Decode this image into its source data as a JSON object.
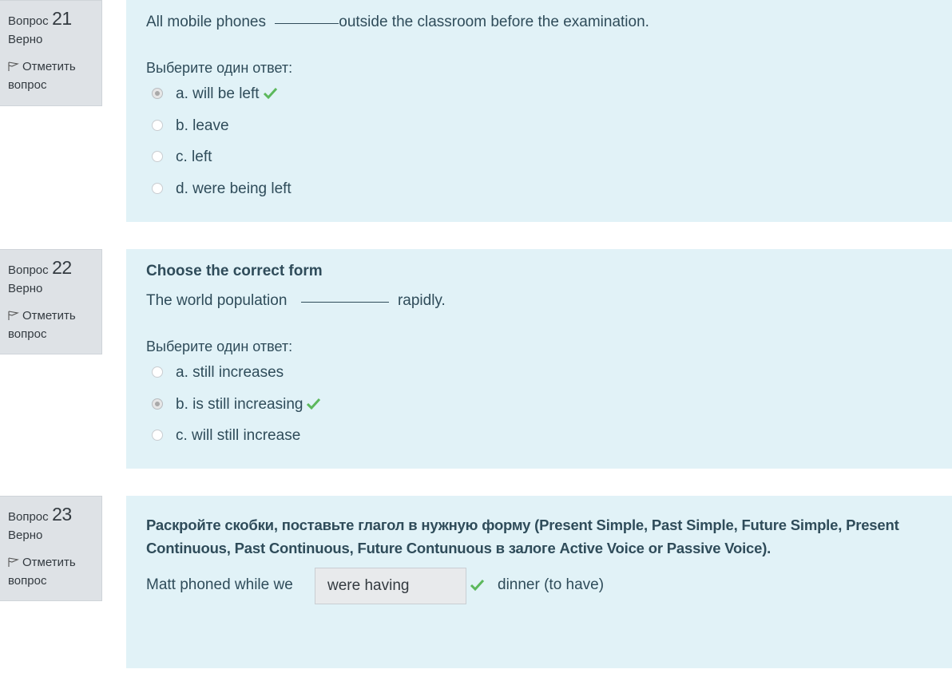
{
  "questions": [
    {
      "label": "Вопрос",
      "number": "21",
      "state": "Верно",
      "flag": "Отметить вопрос",
      "text_before": "All mobile phones",
      "text_after": "outside the classroom before the examination.",
      "prompt": "Выберите один ответ:",
      "answers": [
        {
          "label": "a. will be left",
          "checked": true,
          "correct": true
        },
        {
          "label": "b. leave",
          "checked": false,
          "correct": false
        },
        {
          "label": "c. left",
          "checked": false,
          "correct": false
        },
        {
          "label": "d. were being left",
          "checked": false,
          "correct": false
        }
      ]
    },
    {
      "label": "Вопрос",
      "number": "22",
      "state": "Верно",
      "flag": "Отметить вопрос",
      "title": "Choose the correct form",
      "text_before": "The world population",
      "text_after": "rapidly.",
      "prompt": "Выберите один ответ:",
      "answers": [
        {
          "label": "a. still increases",
          "checked": false,
          "correct": false
        },
        {
          "label": "b. is still increasing",
          "checked": true,
          "correct": true
        },
        {
          "label": "c. will still increase",
          "checked": false,
          "correct": false
        }
      ]
    },
    {
      "label": "Вопрос",
      "number": "23",
      "state": "Верно",
      "flag": "Отметить вопрос",
      "title_line1": "Раскройте скобки, поставьте глагол в нужную форму (Present Simple, Past Simple, Future Simple, Present",
      "title_line2": "Continuous, Past Continuous, Future Contunuous в залоге Active Voice or Passive Voice).",
      "text_before": "Matt phoned while we",
      "input_value": "were having",
      "text_after": "dinner (to have)"
    }
  ],
  "icons": {
    "flag": "flag-icon",
    "check": "check-icon"
  },
  "colors": {
    "content_bg": "#e1f2f7",
    "info_bg": "#dee2e6",
    "text": "#2f4c5a",
    "correct": "#5cb85c"
  }
}
